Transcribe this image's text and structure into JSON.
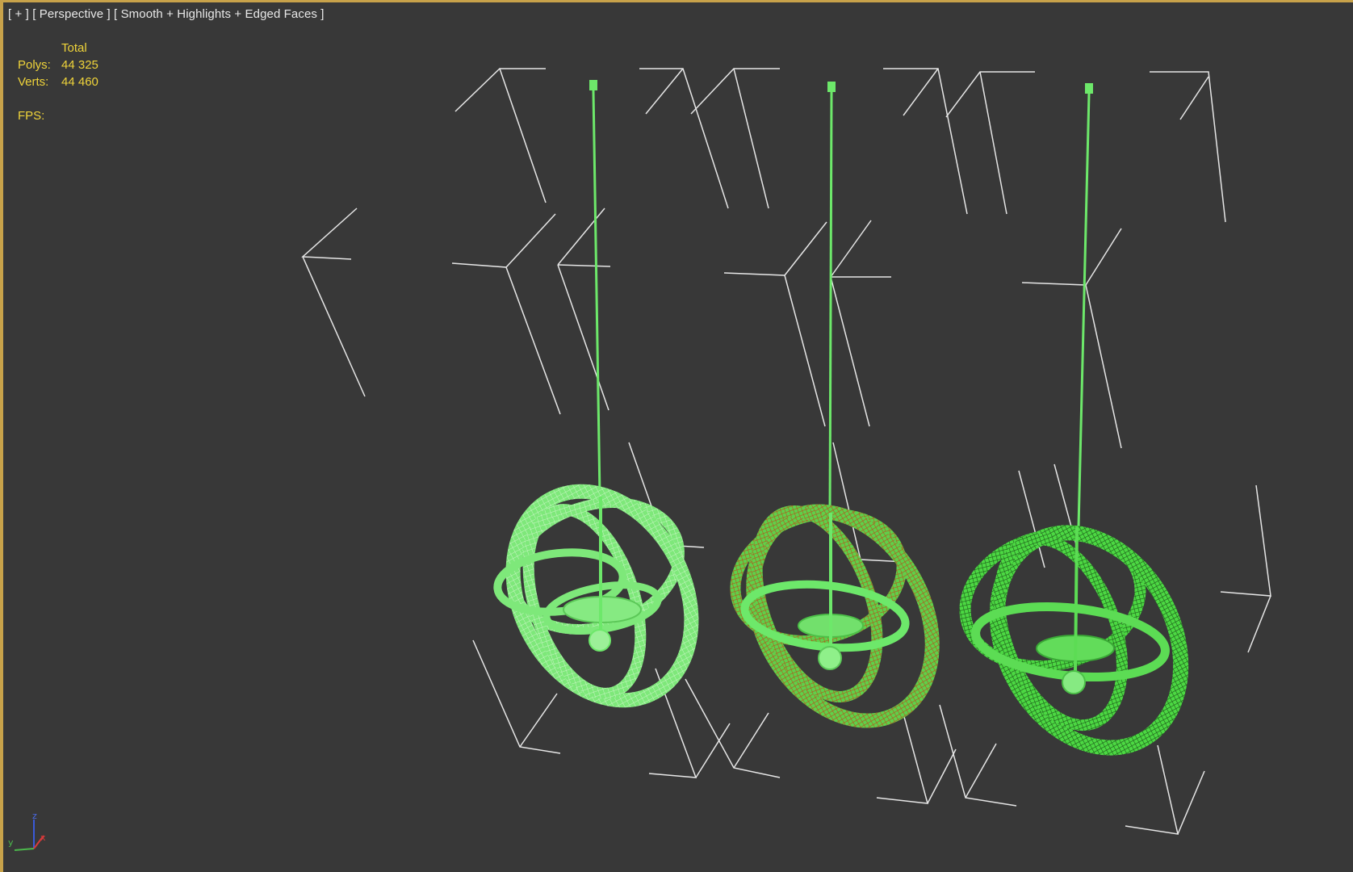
{
  "viewport": {
    "label_plus": "[ + ]",
    "label_view": "[ Perspective ]",
    "label_mode": "[ Smooth + Highlights + Edged Faces ]"
  },
  "stats": {
    "header": "Total",
    "polys_label": "Polys:",
    "polys_value": "44 325",
    "verts_label": "Verts:",
    "verts_value": "44 460",
    "fps_label": "FPS:"
  },
  "axis_gizmo": {
    "z": "z",
    "y": "y",
    "x": "x"
  },
  "colors": {
    "background": "#383838",
    "frame_border": "#c8a24a",
    "stats_text": "#f0d43a",
    "wire_green": "#6de86a",
    "wire_orange": "#c8641e",
    "helper_lines": "#e6e6e6"
  },
  "objects": [
    {
      "name": "gyroscope-lamp-1",
      "style": "light-green"
    },
    {
      "name": "gyroscope-lamp-2",
      "style": "orange-green"
    },
    {
      "name": "gyroscope-lamp-3",
      "style": "dark-green"
    }
  ]
}
